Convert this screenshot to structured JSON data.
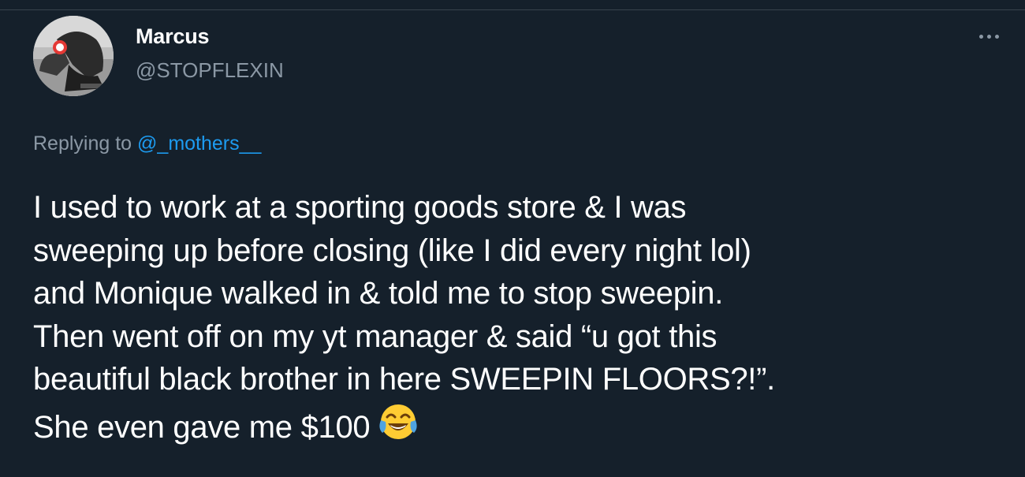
{
  "tweet": {
    "author": {
      "display_name": "Marcus",
      "handle": "@STOPFLEXIN",
      "avatar_icon": "profile-photo"
    },
    "more_icon": "more-horizontal-icon",
    "reply": {
      "prefix": "Replying to",
      "handle": "@_mothers__"
    },
    "body_lines": [
      "I used to work at a sporting goods store & I was",
      "sweeping up before closing (like I did every night lol)",
      "and Monique walked in & told me to stop sweepin.",
      "Then went off on my yt manager & said “u got this",
      "beautiful black brother in here SWEEPIN FLOORS?!”.",
      "She even gave me $100"
    ],
    "emoji_icon": "face-with-tears-of-joy-emoji"
  },
  "colors": {
    "background": "#15202b",
    "text": "#ffffff",
    "secondary_text": "#8b98a5",
    "link": "#1d9bf0",
    "divider": "#38444d"
  }
}
